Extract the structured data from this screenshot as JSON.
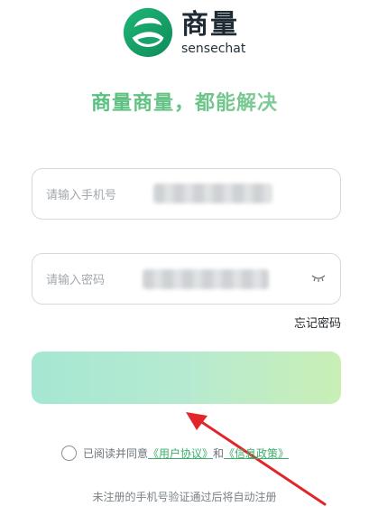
{
  "brand": {
    "name_cn": "商量",
    "name_en": "sensechat",
    "colors": {
      "primary_green": "#2db86a",
      "dark": "#1e2b33"
    }
  },
  "slogan": "商量商量，都能解决",
  "phone_field": {
    "placeholder": "请输入手机号",
    "value_masked": true
  },
  "password_field": {
    "placeholder": "请输入密码",
    "value_masked": true,
    "toggle_icon": "eye-closed-icon"
  },
  "forgot_password": "忘记密码",
  "login_button": {
    "label": ""
  },
  "agreement": {
    "prefix": "已阅读并同意",
    "user_agreement": "《用户协议》",
    "conjunction": "和",
    "privacy_policy": "《信息政策》",
    "checked": false
  },
  "note": "未注册的手机号验证通过后将自动注册"
}
